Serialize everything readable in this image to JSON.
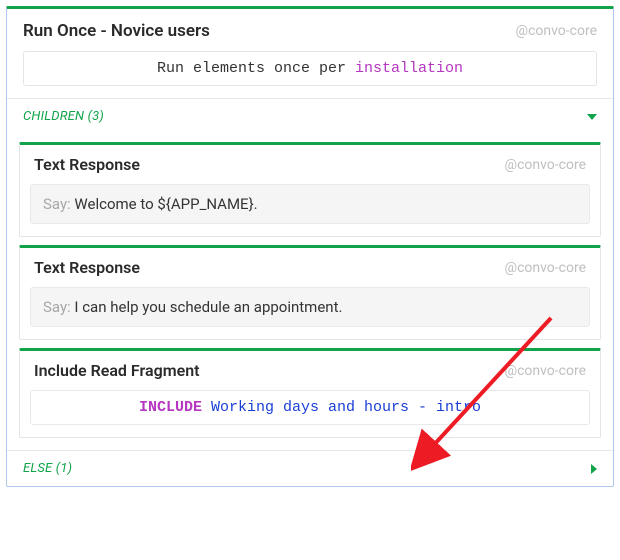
{
  "colors": {
    "accent_green": "#11a34a",
    "border_blue": "#b0c8ef",
    "kw_purple": "#b536c0",
    "kw_blue": "#1a3fd6",
    "tag_grey": "#bfbfbf",
    "arrow_red": "#ed1c24"
  },
  "main": {
    "title": "Run Once - Novice users",
    "tag": "@convo-core",
    "code_prefix": "Run elements once per ",
    "code_kw": "installation"
  },
  "sections": {
    "children_label": "CHILDREN (3)",
    "else_label": "ELSE (1)"
  },
  "children": [
    {
      "title": "Text Response",
      "tag": "@convo-core",
      "say_label": "Say: ",
      "say_text": "Welcome to ${APP_NAME}."
    },
    {
      "title": "Text Response",
      "tag": "@convo-core",
      "say_label": "Say: ",
      "say_text": "I can help you schedule an appointment."
    },
    {
      "title": "Include Read Fragment",
      "tag": "@convo-core",
      "include_kw": "INCLUDE",
      "include_target": "Working days and hours - intro"
    }
  ]
}
